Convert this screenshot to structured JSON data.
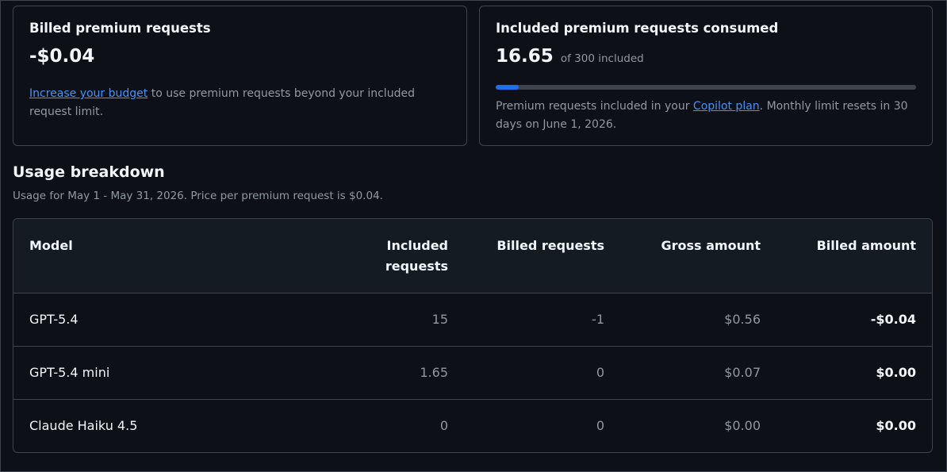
{
  "billed_card": {
    "title": "Billed premium requests",
    "amount": "-$0.04",
    "link_text": "Increase your budget",
    "desc_rest": " to use premium requests beyond your included request limit."
  },
  "included_card": {
    "title": "Included premium requests consumed",
    "consumed": "16.65",
    "of_text": "of 300 included",
    "progress_fraction": 0.0555,
    "desc_before": "Premium requests included in your ",
    "link_text": "Copilot plan",
    "desc_after": ". Monthly limit resets in 30 days on June 1, 2026."
  },
  "usage": {
    "title": "Usage breakdown",
    "subtitle": "Usage for May 1 - May 31, 2026. Price per premium request is $0.04."
  },
  "table": {
    "headers": {
      "model": "Model",
      "included_line1": "Included",
      "included_line2": "requests",
      "billed_requests": "Billed requests",
      "gross_amount": "Gross amount",
      "billed_amount": "Billed amount"
    },
    "rows": [
      {
        "model": "GPT-5.4",
        "included": "15",
        "billed_requests": "-1",
        "gross": "$0.56",
        "billed_amount": "-$0.04"
      },
      {
        "model": "GPT-5.4 mini",
        "included": "1.65",
        "billed_requests": "0",
        "gross": "$0.07",
        "billed_amount": "$0.00"
      },
      {
        "model": "Claude Haiku 4.5",
        "included": "0",
        "billed_requests": "0",
        "gross": "$0.00",
        "billed_amount": "$0.00"
      }
    ]
  },
  "colors": {
    "background": "#0d1117",
    "border": "#3d444d",
    "link": "#4493f8",
    "progress": "#1f6feb",
    "muted_text": "#9198a1"
  }
}
